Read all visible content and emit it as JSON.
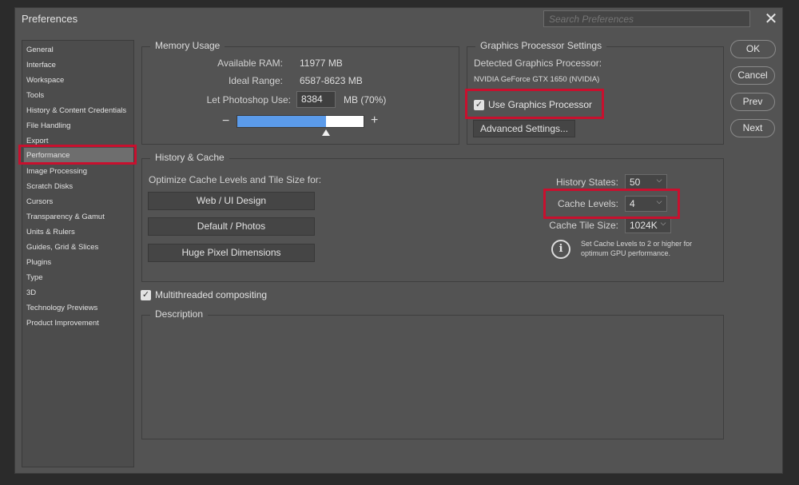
{
  "window": {
    "title": "Preferences",
    "search_placeholder": "Search Preferences",
    "close_glyph": "✕"
  },
  "sidebar": {
    "items": [
      {
        "label": "General"
      },
      {
        "label": "Interface"
      },
      {
        "label": "Workspace"
      },
      {
        "label": "Tools"
      },
      {
        "label": "History & Content Credentials"
      },
      {
        "label": "File Handling"
      },
      {
        "label": "Export"
      },
      {
        "label": "Performance"
      },
      {
        "label": "Image Processing"
      },
      {
        "label": "Scratch Disks"
      },
      {
        "label": "Cursors"
      },
      {
        "label": "Transparency & Gamut"
      },
      {
        "label": "Units & Rulers"
      },
      {
        "label": "Guides, Grid & Slices"
      },
      {
        "label": "Plugins"
      },
      {
        "label": "Type"
      },
      {
        "label": "3D"
      },
      {
        "label": "Technology Previews"
      },
      {
        "label": "Product Improvement"
      }
    ],
    "selected": "Performance"
  },
  "memory": {
    "title": "Memory Usage",
    "available_label": "Available RAM:",
    "available_value": "11977 MB",
    "ideal_label": "Ideal Range:",
    "ideal_value": "6587-8623 MB",
    "use_label": "Let Photoshop Use:",
    "use_value": "8384",
    "use_unit": "MB (70%)",
    "minus": "−",
    "plus": "+",
    "slider_fraction": 0.7
  },
  "gpu": {
    "title": "Graphics Processor Settings",
    "detected_label": "Detected Graphics Processor:",
    "detected_value": "NVIDIA GeForce GTX 1650 (NVIDIA)",
    "use_gpu_label": "Use Graphics Processor",
    "use_gpu_checked": true,
    "advanced_label": "Advanced Settings..."
  },
  "cache": {
    "title": "History & Cache",
    "optimize_label": "Optimize Cache Levels and Tile Size for:",
    "preset_web": "Web / UI Design",
    "preset_default": "Default / Photos",
    "preset_huge": "Huge Pixel Dimensions",
    "history_label": "History States:",
    "history_value": "50",
    "levels_label": "Cache Levels:",
    "levels_value": "4",
    "tile_label": "Cache Tile Size:",
    "tile_value": "1024K",
    "info_line1": "Set Cache Levels to 2 or higher for",
    "info_line2": "optimum GPU performance."
  },
  "multithread": {
    "label": "Multithreaded compositing",
    "checked": true
  },
  "description": {
    "title": "Description"
  },
  "buttons": {
    "ok": "OK",
    "cancel": "Cancel",
    "prev": "Prev",
    "next": "Next"
  },
  "colors": {
    "highlight": "#c8102e",
    "slider_fill": "#5b9bea"
  }
}
